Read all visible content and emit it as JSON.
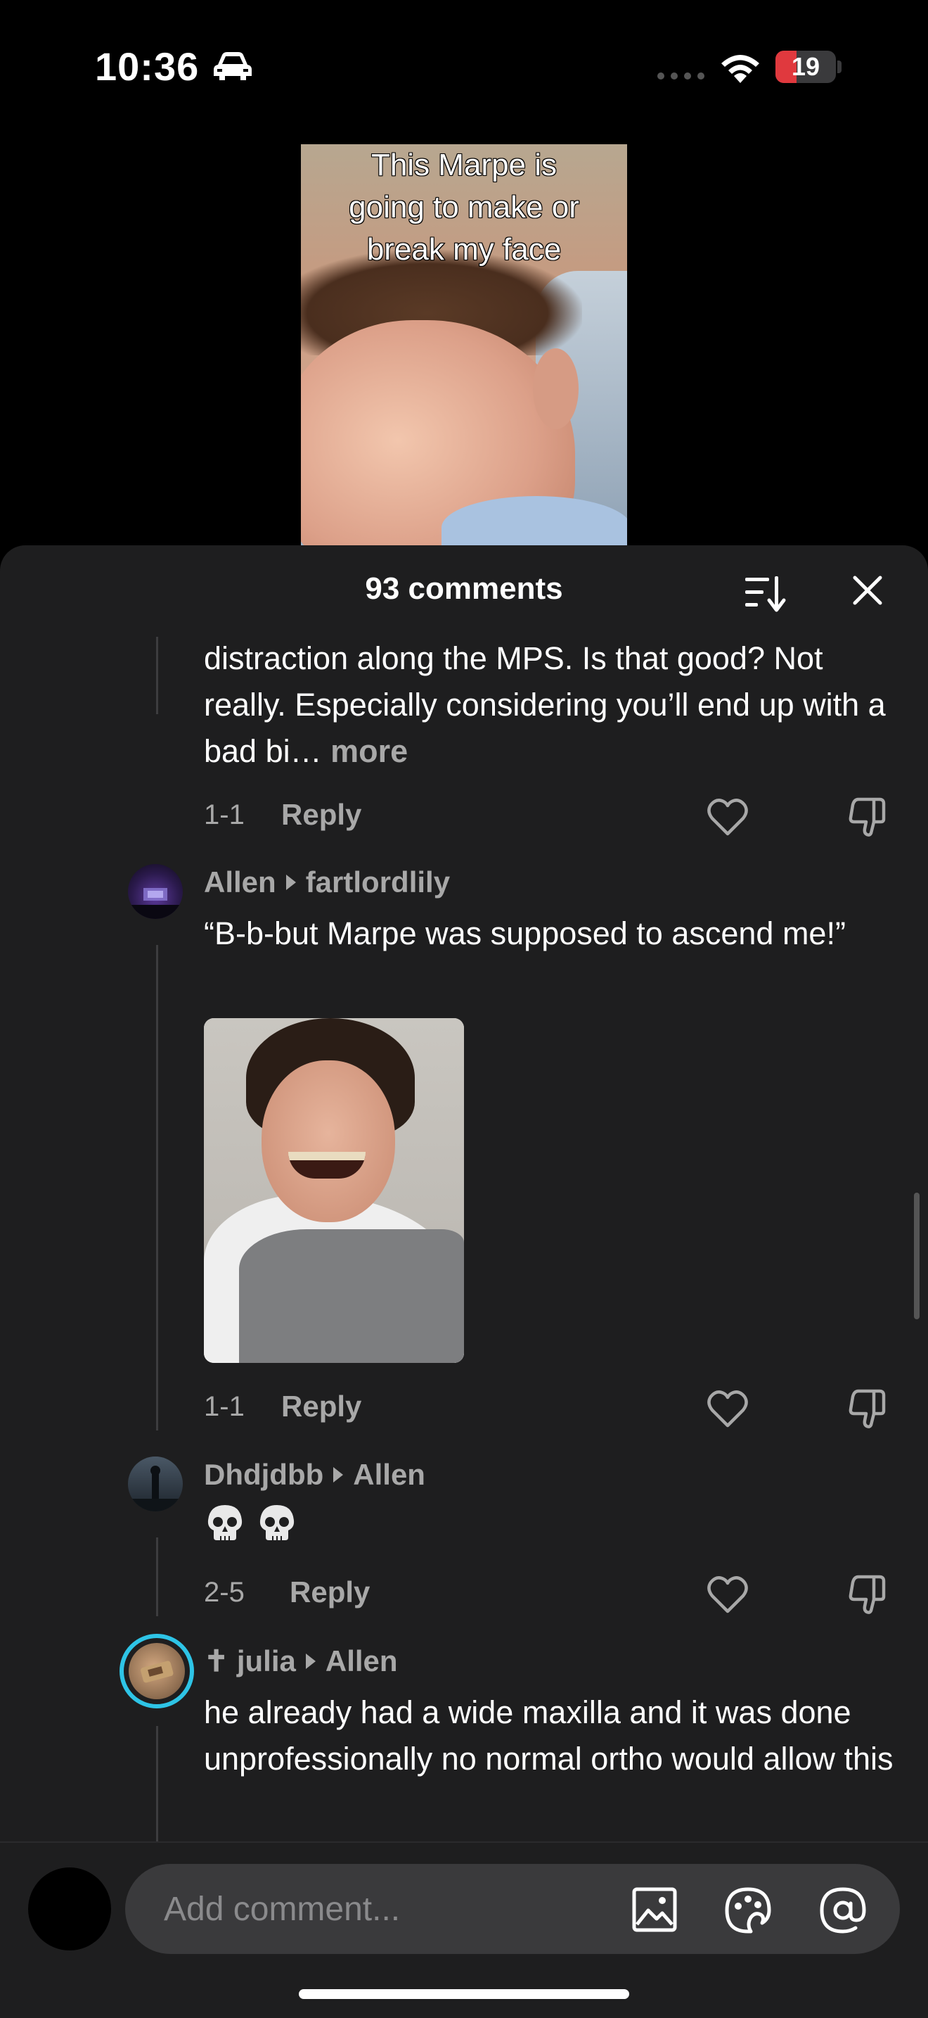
{
  "status_bar": {
    "time": "10:36",
    "battery_level": "19",
    "battery_fraction": 0.19,
    "battery_color": "#e0393e",
    "icons": [
      "car-icon",
      "cellular-dots-icon",
      "wifi-icon",
      "battery-icon"
    ]
  },
  "video": {
    "caption_lines": [
      "This Marpe is",
      "going to make or",
      "break my face"
    ]
  },
  "comments_sheet": {
    "title": "93 comments",
    "icons": [
      "sort-icon",
      "close-icon"
    ],
    "comments": [
      {
        "text": "distraction along the MPS. Is that good? Not really. Especially considering you’ll end up with a bad bi…",
        "more_label": "more",
        "date": "1-1",
        "reply_label": "Reply"
      },
      {
        "author": "Allen",
        "reply_to": "fartlordlily",
        "text": "“B-b-but Marpe was supposed to ascend me!”",
        "has_image": true,
        "date": "1-1",
        "reply_label": "Reply"
      },
      {
        "author": "Dhdjdbb",
        "reply_to": "Allen",
        "emoji": "💀💀",
        "date": "2-5",
        "reply_label": "Reply"
      },
      {
        "author": "✝ julia",
        "reply_to": "Allen",
        "text": "he already had a wide maxilla and it was done unprofessionally no normal ortho would allow this"
      }
    ]
  },
  "composer": {
    "placeholder": "Add comment...",
    "icons": [
      "image-icon",
      "sticker-icon",
      "at-icon"
    ]
  },
  "colors": {
    "sheet_bg": "#1e1e1f",
    "secondary_text": "#a8a8a8",
    "input_bg": "#3a3a3c",
    "story_ring": "#2ec4e6"
  }
}
